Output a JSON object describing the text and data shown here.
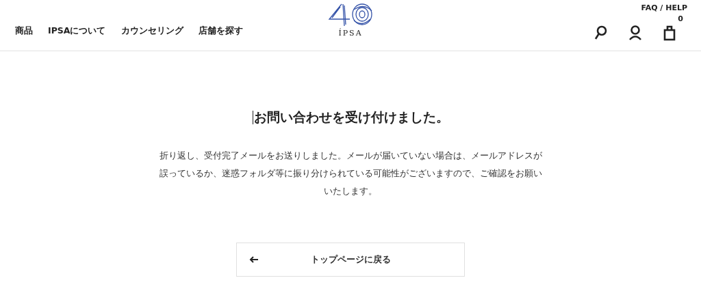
{
  "header": {
    "nav": [
      "商品",
      "IPSAについて",
      "カウンセリング",
      "店舗を探す"
    ],
    "logo": {
      "wordmark": "ÍPSA"
    },
    "help_link": "FAQ / HELP",
    "cart_count": "0"
  },
  "main": {
    "title": "お問い合わせを受け付けました。",
    "message": "折り返し、受付完了メールをお送りしました。メールが届いていない場合は、メールアドレスが誤っているか、迷惑フォルダ等に振り分けられている可能性がございますので、ご確認をお願いいたします。",
    "back_button": "トップページに戻る"
  }
}
